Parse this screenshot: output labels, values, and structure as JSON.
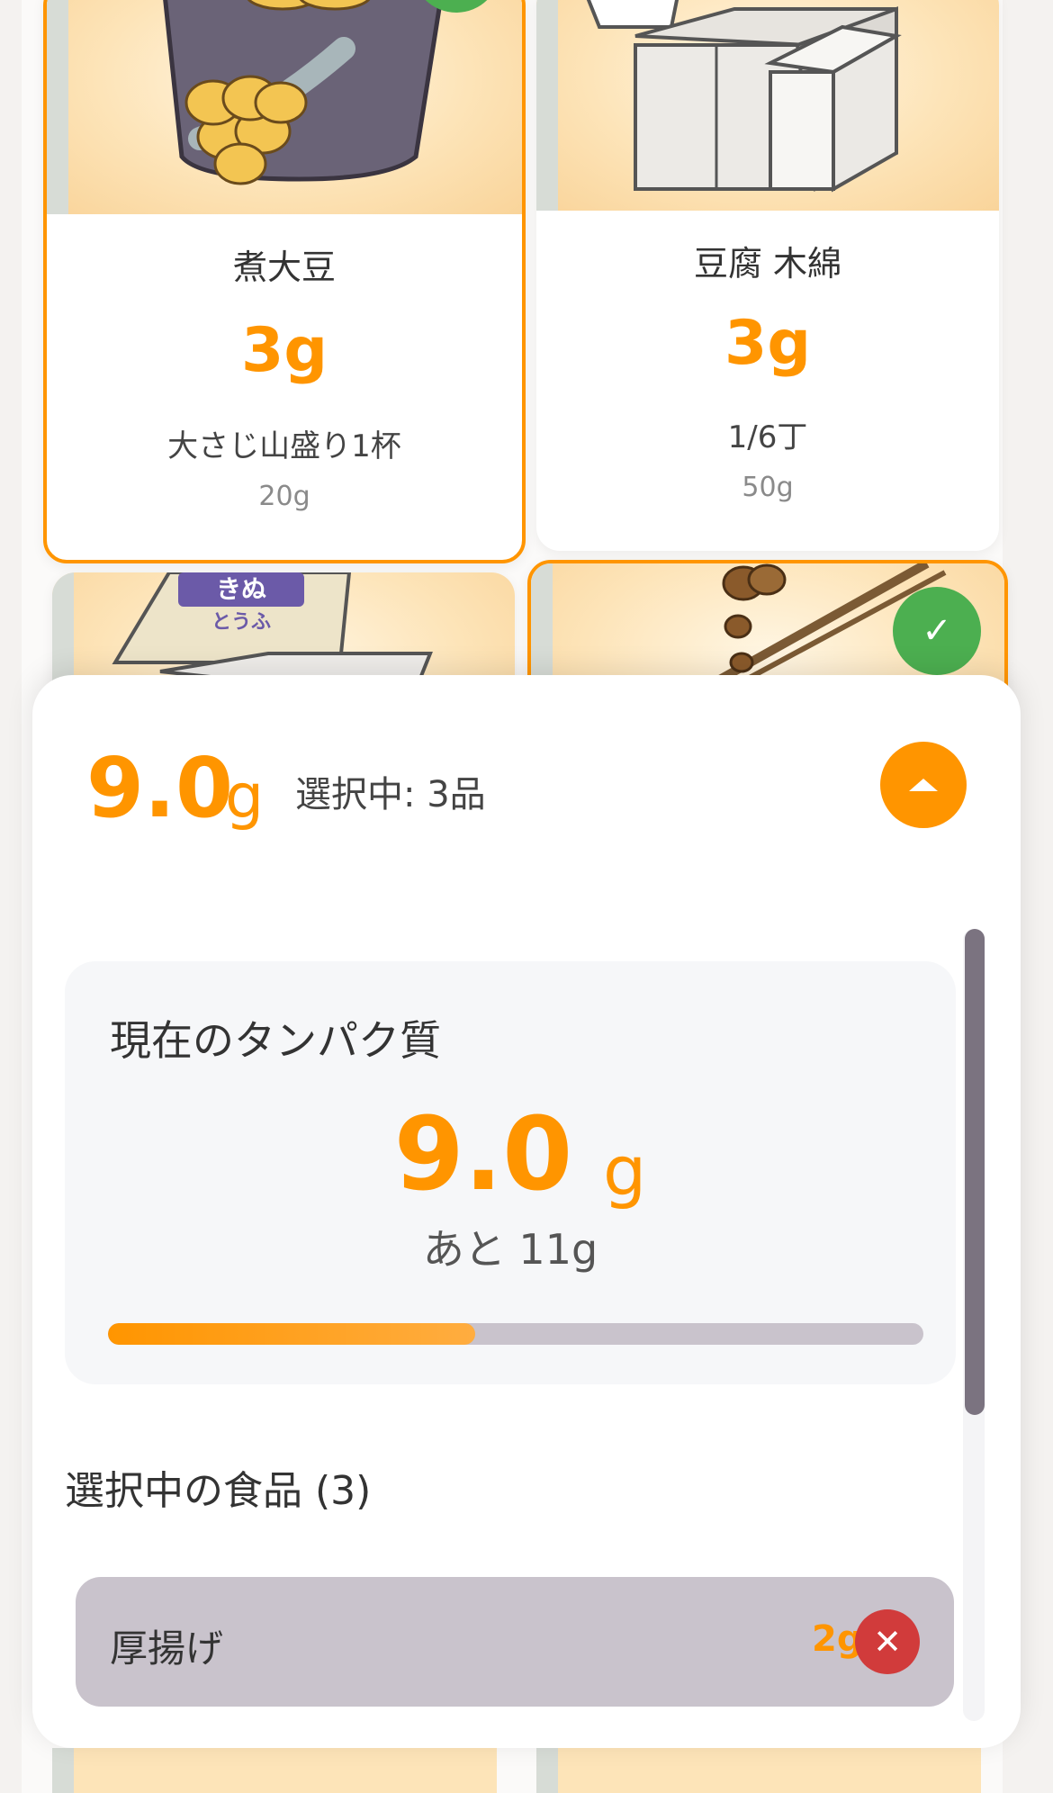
{
  "cards": [
    {
      "name": "煮大豆",
      "protein": "3g",
      "portion": "大さじ山盛り1杯",
      "weight": "20g",
      "selected": true
    },
    {
      "name": "豆腐 木綿",
      "protein": "3g",
      "portion": "1/6丁",
      "weight": "50g",
      "selected": false
    }
  ],
  "partial_card": {
    "package_text": "きぬ",
    "package_sub": "とうふ"
  },
  "check_glyph": "✓",
  "sheet": {
    "total_value": "9.0",
    "unit": "g",
    "selected_count": "選択中: 3品",
    "panel": {
      "title": "現在のタンパク質",
      "value": "9.0",
      "unit": "g",
      "remaining": "あと 11g",
      "progress_fraction": 0.45
    },
    "section_title": "選択中の食品 (3)",
    "items": [
      {
        "name": "厚揚げ",
        "protein": "2g"
      }
    ]
  },
  "icons": {
    "toggle": "chevron-up-icon",
    "remove": "close-icon",
    "check": "check-icon"
  },
  "colors": {
    "accent": "#ff9500",
    "check": "#4caf50",
    "remove": "#d13b3b"
  }
}
